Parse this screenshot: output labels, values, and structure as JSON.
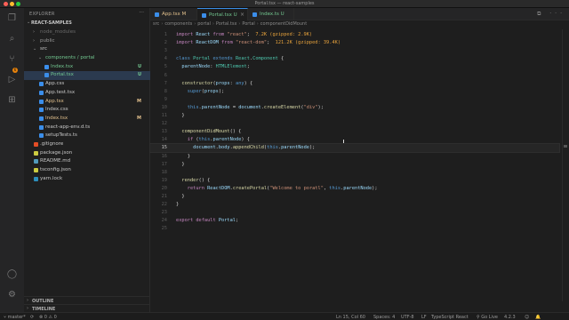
{
  "window": {
    "title": "Portal.tsx — react-samples"
  },
  "activity_bar": {
    "items": [
      {
        "icon": "files-icon",
        "glyph": "❐"
      },
      {
        "icon": "search-icon",
        "glyph": "⌕"
      },
      {
        "icon": "source-control-icon",
        "glyph": "⑂"
      },
      {
        "icon": "run-debug-icon",
        "glyph": "▷"
      },
      {
        "icon": "extensions-icon",
        "glyph": "⊞"
      },
      {
        "icon": "accounts-icon",
        "glyph": "◯"
      },
      {
        "icon": "settings-gear-icon",
        "glyph": "⚙"
      }
    ],
    "scm_badge": "6"
  },
  "sidebar": {
    "title": "EXPLORER",
    "more": "···",
    "project": "REACT-SAMPLES",
    "items": [
      {
        "name": "node_modules",
        "kind": "folder",
        "open": false,
        "depth": 1,
        "color": "#6a6a6a",
        "badge": "",
        "badge_color": ""
      },
      {
        "name": "public",
        "kind": "folder",
        "open": false,
        "depth": 1,
        "color": "#9a9a9a",
        "badge": "",
        "badge_color": ""
      },
      {
        "name": "src",
        "kind": "folder",
        "open": true,
        "depth": 1,
        "color": "#c8c8c8",
        "badge": "",
        "badge_color": "#73c991"
      },
      {
        "name": "components / portal",
        "kind": "folder",
        "open": true,
        "depth": 2,
        "color": "#73c991",
        "badge": "",
        "badge_color": "#73c991"
      },
      {
        "name": "Index.tsx",
        "kind": "file",
        "depth": 3,
        "color": "#73c991",
        "icon_color": "#3b8eea",
        "badge": "U",
        "badge_color": "#73c991"
      },
      {
        "name": "Portal.tsx",
        "kind": "file",
        "depth": 3,
        "color": "#73c991",
        "icon_color": "#3b8eea",
        "badge": "U",
        "badge_color": "#73c991",
        "selected": true
      },
      {
        "name": "App.css",
        "kind": "file",
        "depth": 2,
        "color": "#c8c8c8",
        "icon_color": "#3b8eea",
        "badge": "",
        "badge_color": ""
      },
      {
        "name": "App.test.tsx",
        "kind": "file",
        "depth": 2,
        "color": "#c8c8c8",
        "icon_color": "#3b8eea",
        "badge": "",
        "badge_color": ""
      },
      {
        "name": "App.tsx",
        "kind": "file",
        "depth": 2,
        "color": "#e2c08d",
        "icon_color": "#3b8eea",
        "badge": "M",
        "badge_color": "#e2c08d"
      },
      {
        "name": "Index.css",
        "kind": "file",
        "depth": 2,
        "color": "#c8c8c8",
        "icon_color": "#3b8eea",
        "badge": "",
        "badge_color": ""
      },
      {
        "name": "Index.tsx",
        "kind": "file",
        "depth": 2,
        "color": "#e2c08d",
        "icon_color": "#3b8eea",
        "badge": "M",
        "badge_color": "#e2c08d"
      },
      {
        "name": "react-app-env.d.ts",
        "kind": "file",
        "depth": 2,
        "color": "#c8c8c8",
        "icon_color": "#3b8eea",
        "badge": "",
        "badge_color": ""
      },
      {
        "name": "setupTests.ts",
        "kind": "file",
        "depth": 2,
        "color": "#c8c8c8",
        "icon_color": "#3b8eea",
        "badge": "",
        "badge_color": ""
      },
      {
        "name": ".gitignore",
        "kind": "file",
        "depth": 1,
        "color": "#c8c8c8",
        "icon_color": "#e44d26",
        "badge": "",
        "badge_color": ""
      },
      {
        "name": "package.json",
        "kind": "file",
        "depth": 1,
        "color": "#c8c8c8",
        "icon_color": "#cbcb41",
        "badge": "",
        "badge_color": ""
      },
      {
        "name": "README.md",
        "kind": "file",
        "depth": 1,
        "color": "#c8c8c8",
        "icon_color": "#519aba",
        "badge": "",
        "badge_color": ""
      },
      {
        "name": "tsconfig.json",
        "kind": "file",
        "depth": 1,
        "color": "#c8c8c8",
        "icon_color": "#cbcb41",
        "badge": "",
        "badge_color": ""
      },
      {
        "name": "yarn.lock",
        "kind": "file",
        "depth": 1,
        "color": "#c8c8c8",
        "icon_color": "#2c8ebb",
        "badge": "",
        "badge_color": ""
      }
    ],
    "outline_label": "OUTLINE",
    "timeline_label": "TIMELINE"
  },
  "tabs": [
    {
      "label": "App.tsx M",
      "color": "#e2c08d",
      "icon_color": "#3b8eea",
      "active": false
    },
    {
      "label": "Portal.tsx U",
      "color": "#73c991",
      "icon_color": "#3b8eea",
      "active": true
    },
    {
      "label": "Index.ts U",
      "color": "#73c991",
      "icon_color": "#3b8eea",
      "active": false
    }
  ],
  "tab_actions": "⧉ ···",
  "breadcrumbs": [
    "src",
    "components",
    "portal",
    "Portal.tsx",
    "Portal",
    "componentDidMount"
  ],
  "editor": {
    "current_line": 15,
    "lines": [
      {
        "n": 1,
        "tokens": [
          [
            "kw",
            "import "
          ],
          [
            "var",
            "React "
          ],
          [
            "kw",
            "from "
          ],
          [
            "str",
            "\"react\""
          ],
          [
            "pun",
            ";  "
          ],
          [
            "hint",
            "7.2K (gzipped: 2.9K)"
          ]
        ]
      },
      {
        "n": 2,
        "tokens": [
          [
            "kw",
            "import "
          ],
          [
            "var",
            "ReactDOM "
          ],
          [
            "kw",
            "from "
          ],
          [
            "str",
            "\"react-dom\""
          ],
          [
            "pun",
            ";  "
          ],
          [
            "hint",
            "121.2K (gzipped: 39.4K)"
          ]
        ]
      },
      {
        "n": 3,
        "tokens": []
      },
      {
        "n": 4,
        "tokens": [
          [
            "kw2",
            "class "
          ],
          [
            "cls",
            "Portal "
          ],
          [
            "kw2",
            "extends "
          ],
          [
            "cls",
            "React"
          ],
          [
            "pun",
            "."
          ],
          [
            "cls",
            "Component "
          ],
          [
            "pun",
            "{"
          ]
        ]
      },
      {
        "n": 5,
        "tokens": [
          [
            "var",
            "  parentNode"
          ],
          [
            "pun",
            ": "
          ],
          [
            "cls",
            "HTMLElement"
          ],
          [
            "pun",
            ";"
          ]
        ]
      },
      {
        "n": 6,
        "tokens": []
      },
      {
        "n": 7,
        "tokens": [
          [
            "fn",
            "  constructor"
          ],
          [
            "pun",
            "("
          ],
          [
            "var",
            "props"
          ],
          [
            "pun",
            ": "
          ],
          [
            "kw2",
            "any"
          ],
          [
            "pun",
            ") {"
          ]
        ]
      },
      {
        "n": 8,
        "tokens": [
          [
            "kw2",
            "    super"
          ],
          [
            "pun",
            "("
          ],
          [
            "var",
            "props"
          ],
          [
            "pun",
            ");"
          ]
        ]
      },
      {
        "n": 9,
        "tokens": []
      },
      {
        "n": 10,
        "tokens": [
          [
            "kw2",
            "    this"
          ],
          [
            "pun",
            "."
          ],
          [
            "var",
            "parentNode "
          ],
          [
            "pun",
            "= "
          ],
          [
            "var",
            "document"
          ],
          [
            "pun",
            "."
          ],
          [
            "fn",
            "createElement"
          ],
          [
            "pun",
            "("
          ],
          [
            "str",
            "\"div\""
          ],
          [
            "pun",
            ");"
          ]
        ]
      },
      {
        "n": 11,
        "tokens": [
          [
            "pun",
            "  }"
          ]
        ]
      },
      {
        "n": 12,
        "tokens": []
      },
      {
        "n": 13,
        "tokens": [
          [
            "fn",
            "  componentDidMount"
          ],
          [
            "pun",
            "() {"
          ]
        ]
      },
      {
        "n": 14,
        "tokens": [
          [
            "kw",
            "    if "
          ],
          [
            "pun",
            "("
          ],
          [
            "kw2",
            "this"
          ],
          [
            "pun",
            "."
          ],
          [
            "var",
            "parentNode"
          ],
          [
            "pun",
            ") {"
          ]
        ]
      },
      {
        "n": 15,
        "tokens": [
          [
            "var",
            "      document"
          ],
          [
            "pun",
            "."
          ],
          [
            "var",
            "body"
          ],
          [
            "pun",
            "."
          ],
          [
            "fn",
            "appendChild"
          ],
          [
            "pun",
            "("
          ],
          [
            "kw2",
            "this"
          ],
          [
            "pun",
            "."
          ],
          [
            "var",
            "parentNode"
          ],
          [
            "pun",
            ");"
          ]
        ]
      },
      {
        "n": 16,
        "tokens": [
          [
            "pun",
            "    }"
          ]
        ]
      },
      {
        "n": 17,
        "tokens": [
          [
            "pun",
            "  }"
          ]
        ]
      },
      {
        "n": 18,
        "tokens": []
      },
      {
        "n": 19,
        "tokens": [
          [
            "fn",
            "  render"
          ],
          [
            "pun",
            "() {"
          ]
        ]
      },
      {
        "n": 20,
        "tokens": [
          [
            "kw",
            "    return "
          ],
          [
            "var",
            "ReactDOM"
          ],
          [
            "pun",
            "."
          ],
          [
            "fn",
            "createPortal"
          ],
          [
            "pun",
            "("
          ],
          [
            "str",
            "\"Welcome to poratl\""
          ],
          [
            "pun",
            ", "
          ],
          [
            "kw2",
            "this"
          ],
          [
            "pun",
            "."
          ],
          [
            "var",
            "parentNode"
          ],
          [
            "pun",
            ");"
          ]
        ]
      },
      {
        "n": 21,
        "tokens": [
          [
            "pun",
            "  }"
          ]
        ]
      },
      {
        "n": 22,
        "tokens": [
          [
            "pun",
            "}"
          ]
        ]
      },
      {
        "n": 23,
        "tokens": []
      },
      {
        "n": 24,
        "tokens": [
          [
            "kw",
            "export default "
          ],
          [
            "var",
            "Portal"
          ],
          [
            "pun",
            ";"
          ]
        ]
      },
      {
        "n": 25,
        "tokens": []
      }
    ]
  },
  "statusbar": {
    "branch": "master*",
    "sync": "⟳",
    "problems": "⊗ 0 ⚠ 0",
    "position": "Ln 15, Col 60",
    "spaces": "Spaces: 4",
    "encoding": "UTF-8",
    "eol": "LF",
    "language": "TypeScript React",
    "golive": "⚲ Go Live",
    "version": "4.2.3",
    "feedback": "☺",
    "bell": "🔔"
  }
}
